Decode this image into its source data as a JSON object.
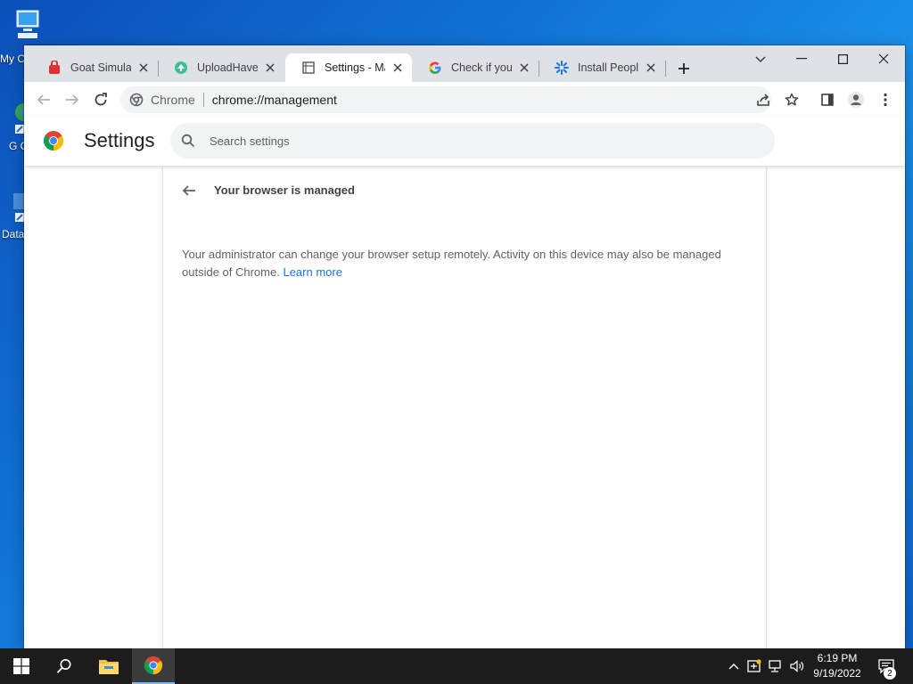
{
  "desktop": {
    "icons": [
      {
        "label": "My C"
      },
      {
        "label": "G C"
      },
      {
        "label": "Data"
      }
    ]
  },
  "browser": {
    "tabs": [
      {
        "title": "Goat Simulato",
        "favicon": "goat-icon",
        "active": false
      },
      {
        "title": "UploadHaven",
        "favicon": "uploadhaven-icon",
        "active": false
      },
      {
        "title": "Settings - Man",
        "favicon": "document-icon",
        "active": true
      },
      {
        "title": "Check if your C",
        "favicon": "google-icon",
        "active": false
      },
      {
        "title": "Install People I",
        "favicon": "puzzle-icon",
        "active": false
      }
    ],
    "omnibox": {
      "site_label": "Chrome",
      "url": "chrome://management"
    }
  },
  "settings": {
    "title": "Settings",
    "search_placeholder": "Search settings",
    "page_title": "Your browser is managed",
    "description": "Your administrator can change your browser setup remotely. Activity on this device may also be managed outside of Chrome.",
    "learn_more": "Learn more"
  },
  "taskbar": {
    "time": "6:19 PM",
    "date": "9/19/2022",
    "notification_count": "2"
  },
  "colors": {
    "accent": "#1a73e8",
    "taskbar": "#1c1c1c",
    "tabstrip": "#dee1e6"
  }
}
